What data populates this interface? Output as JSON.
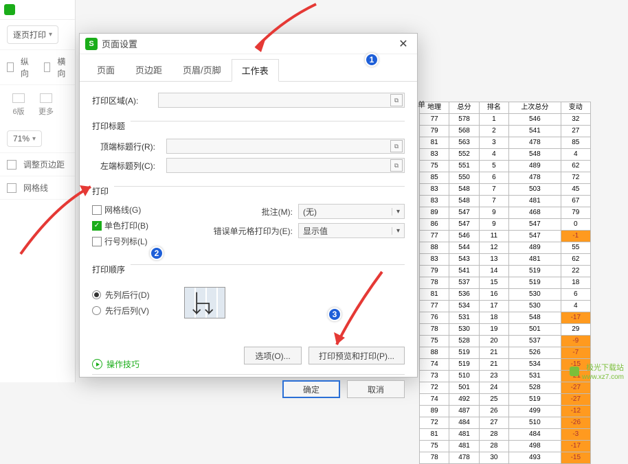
{
  "left_panel": {
    "page_print": "逐页打印",
    "orientation_portrait": "纵向",
    "orientation_landscape": "横向",
    "grid_6": "6版",
    "more": "更多",
    "zoom": "71%",
    "fit_margins": "调整页边距",
    "gridlines": "网格线"
  },
  "dialog": {
    "title": "页面设置",
    "tabs": {
      "page": "页面",
      "margins": "页边距",
      "headerfooter": "页眉/页脚",
      "sheet": "工作表"
    },
    "print_area_label": "打印区域(A):",
    "print_titles_label": "打印标题",
    "top_title_rows_label": "顶端标题行(R):",
    "left_title_cols_label": "左端标题列(C):",
    "print_section_label": "打印",
    "chk_gridlines": "网格线(G)",
    "chk_blackwhite": "单色打印(B)",
    "chk_rowcolheaders": "行号列标(L)",
    "comments_label": "批注(M):",
    "comments_value": "(无)",
    "errors_label": "错误单元格打印为(E):",
    "errors_value": "显示值",
    "order_label": "打印顺序",
    "order_down_then_over": "先列后行(D)",
    "order_over_then_down": "先行后列(V)",
    "btn_options": "选项(O)...",
    "btn_preview_print": "打印预览和打印(P)...",
    "btn_ok": "确定",
    "btn_cancel": "取消",
    "tips": "操作技巧"
  },
  "badge": {
    "one": "1",
    "two": "2",
    "three": "3"
  },
  "bg_header_frag": "单",
  "table": {
    "headers": [
      "地理",
      "总分",
      "排名",
      "上次总分",
      "变动"
    ],
    "rows": [
      [
        "77",
        "578",
        "1",
        "546",
        "32"
      ],
      [
        "79",
        "568",
        "2",
        "541",
        "27"
      ],
      [
        "81",
        "563",
        "3",
        "478",
        "85"
      ],
      [
        "83",
        "552",
        "4",
        "548",
        "4"
      ],
      [
        "75",
        "551",
        "5",
        "489",
        "62"
      ],
      [
        "85",
        "550",
        "6",
        "478",
        "72"
      ],
      [
        "83",
        "548",
        "7",
        "503",
        "45"
      ],
      [
        "83",
        "548",
        "7",
        "481",
        "67"
      ],
      [
        "89",
        "547",
        "9",
        "468",
        "79"
      ],
      [
        "86",
        "547",
        "9",
        "547",
        "0"
      ],
      [
        "77",
        "546",
        "11",
        "547",
        "-1"
      ],
      [
        "88",
        "544",
        "12",
        "489",
        "55"
      ],
      [
        "83",
        "543",
        "13",
        "481",
        "62"
      ],
      [
        "79",
        "541",
        "14",
        "519",
        "22"
      ],
      [
        "78",
        "537",
        "15",
        "519",
        "18"
      ],
      [
        "81",
        "536",
        "16",
        "530",
        "6"
      ],
      [
        "77",
        "534",
        "17",
        "530",
        "4"
      ],
      [
        "76",
        "531",
        "18",
        "548",
        "-17"
      ],
      [
        "78",
        "530",
        "19",
        "501",
        "29"
      ],
      [
        "75",
        "528",
        "20",
        "537",
        "-9"
      ],
      [
        "88",
        "519",
        "21",
        "526",
        "-7"
      ],
      [
        "74",
        "519",
        "21",
        "534",
        "-15"
      ],
      [
        "73",
        "510",
        "23",
        "531",
        "-21"
      ],
      [
        "72",
        "501",
        "24",
        "528",
        "-27"
      ],
      [
        "74",
        "492",
        "25",
        "519",
        "-27"
      ],
      [
        "89",
        "487",
        "26",
        "499",
        "-12"
      ],
      [
        "72",
        "484",
        "27",
        "510",
        "-26"
      ],
      [
        "81",
        "481",
        "28",
        "484",
        "-3"
      ],
      [
        "75",
        "481",
        "28",
        "498",
        "-17"
      ],
      [
        "78",
        "478",
        "30",
        "493",
        "-15"
      ]
    ]
  },
  "watermark": {
    "name": "极光下载站",
    "url": "www.xz7.com"
  }
}
